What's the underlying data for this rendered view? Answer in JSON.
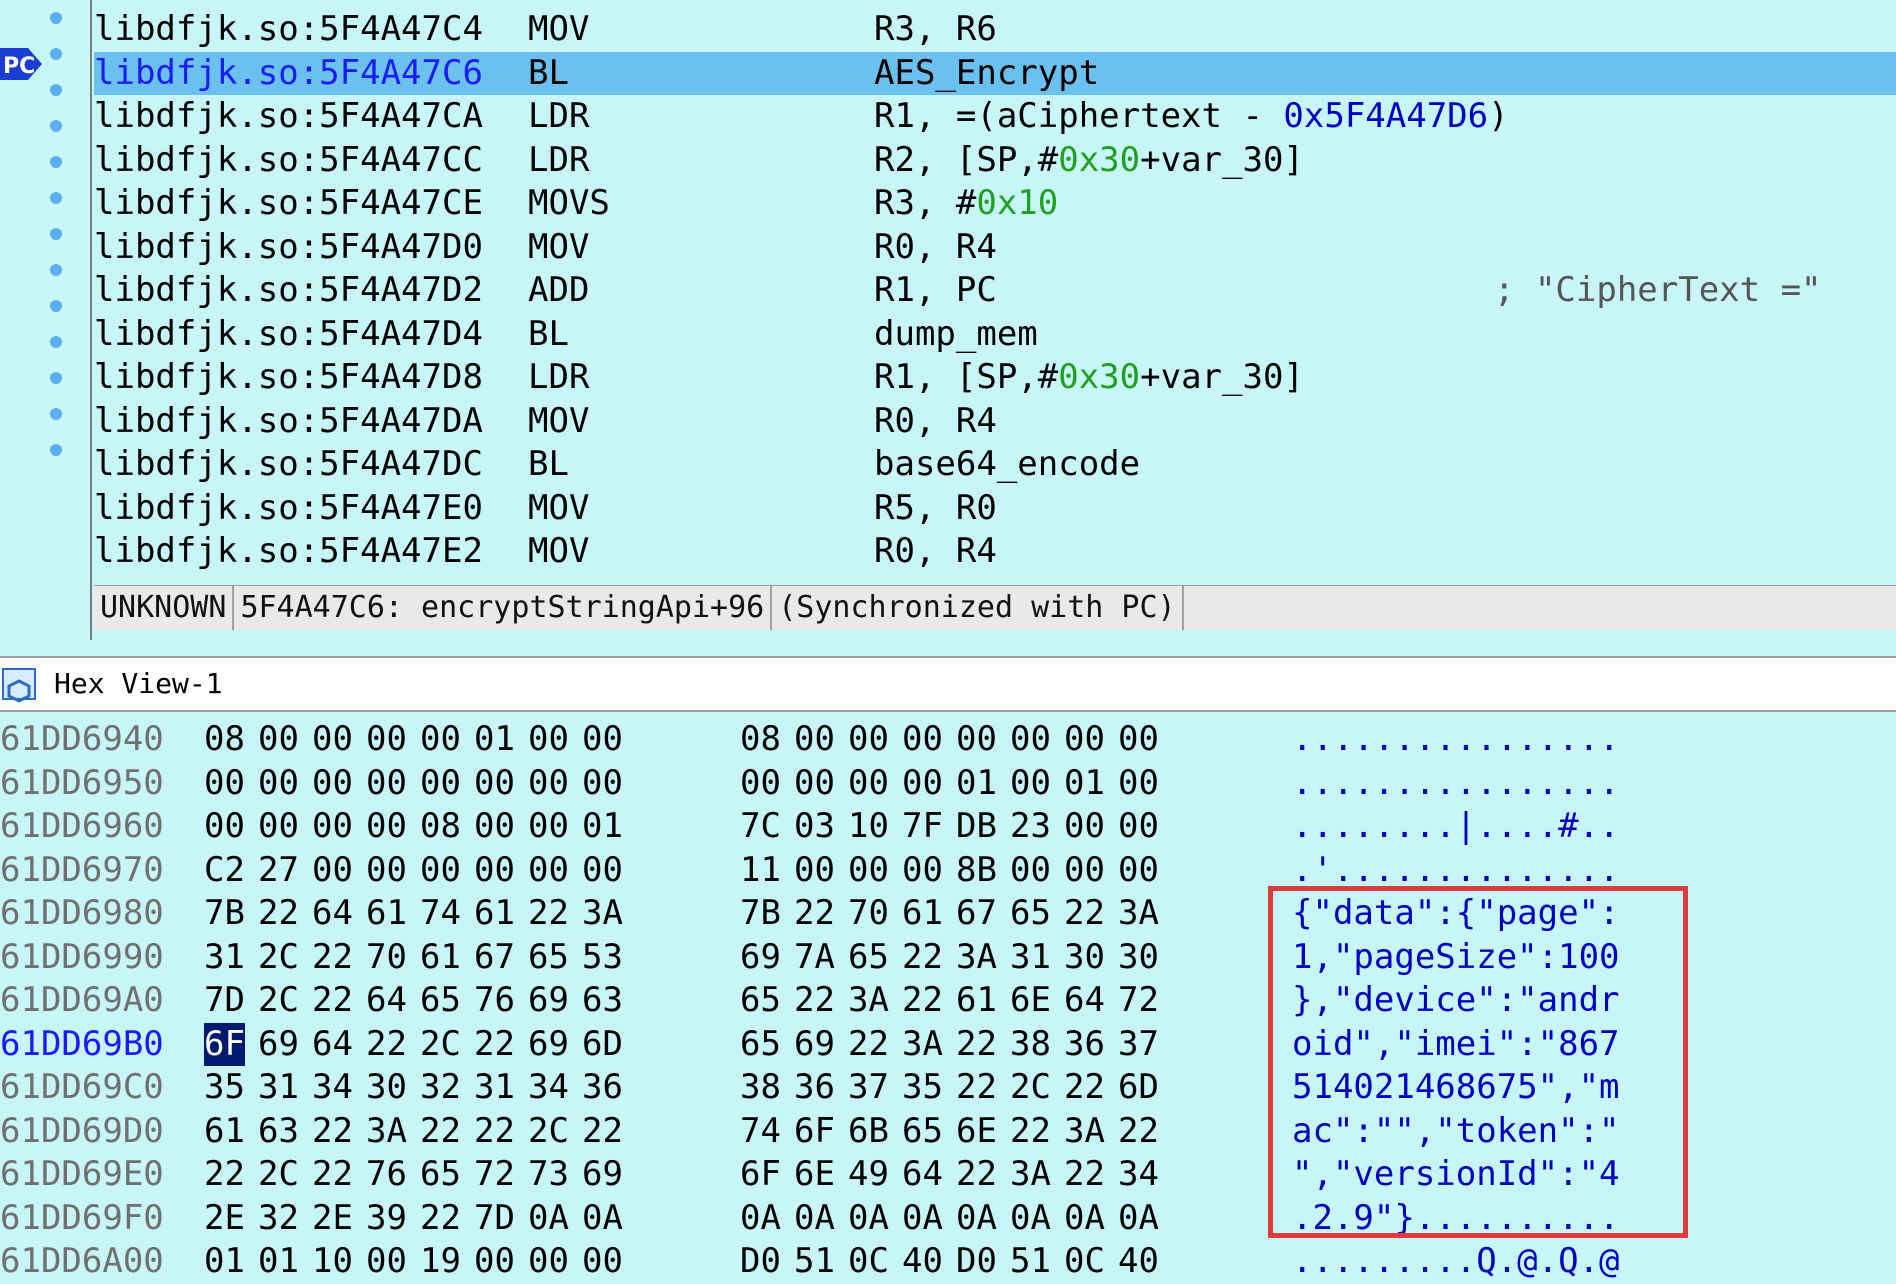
{
  "disasm": {
    "rows": [
      {
        "addr": "libdfjk.so:5F4A47C4",
        "mnemonic": "MOV",
        "operands": [
          [
            "R3, R6",
            ""
          ]
        ],
        "comment": ""
      },
      {
        "addr": "libdfjk.so:5F4A47C6",
        "mnemonic": "BL",
        "operands": [
          [
            "AES_Encrypt",
            ""
          ]
        ],
        "comment": "",
        "current": true
      },
      {
        "addr": "libdfjk.so:5F4A47CA",
        "mnemonic": "LDR",
        "operands": [
          [
            "R1, =(aCiphertext - ",
            ""
          ],
          [
            "0x5F4A47D6",
            "sym"
          ],
          [
            ")",
            ""
          ]
        ],
        "comment": ""
      },
      {
        "addr": "libdfjk.so:5F4A47CC",
        "mnemonic": "LDR",
        "operands": [
          [
            "R2, [SP,#",
            ""
          ],
          [
            "0x30",
            "num"
          ],
          [
            "+var_30]",
            ""
          ]
        ],
        "comment": ""
      },
      {
        "addr": "libdfjk.so:5F4A47CE",
        "mnemonic": "MOVS",
        "operands": [
          [
            "R3, #",
            ""
          ],
          [
            "0x10",
            "num"
          ]
        ],
        "comment": ""
      },
      {
        "addr": "libdfjk.so:5F4A47D0",
        "mnemonic": "MOV",
        "operands": [
          [
            "R0, R4",
            ""
          ]
        ],
        "comment": ""
      },
      {
        "addr": "libdfjk.so:5F4A47D2",
        "mnemonic": "ADD",
        "operands": [
          [
            "R1, PC",
            ""
          ]
        ],
        "comment": "; \"CipherText =\""
      },
      {
        "addr": "libdfjk.so:5F4A47D4",
        "mnemonic": "BL",
        "operands": [
          [
            "dump_mem",
            ""
          ]
        ],
        "comment": ""
      },
      {
        "addr": "libdfjk.so:5F4A47D8",
        "mnemonic": "LDR",
        "operands": [
          [
            "R1, [SP,#",
            ""
          ],
          [
            "0x30",
            "num"
          ],
          [
            "+var_30]",
            ""
          ]
        ],
        "comment": ""
      },
      {
        "addr": "libdfjk.so:5F4A47DA",
        "mnemonic": "MOV",
        "operands": [
          [
            "R0, R4",
            ""
          ]
        ],
        "comment": ""
      },
      {
        "addr": "libdfjk.so:5F4A47DC",
        "mnemonic": "BL",
        "operands": [
          [
            "base64_encode",
            ""
          ]
        ],
        "comment": ""
      },
      {
        "addr": "libdfjk.so:5F4A47E0",
        "mnemonic": "MOV",
        "operands": [
          [
            "R5, R0",
            ""
          ]
        ],
        "comment": ""
      },
      {
        "addr": "libdfjk.so:5F4A47E2",
        "mnemonic": "MOV",
        "operands": [
          [
            "R0, R4",
            ""
          ]
        ],
        "comment": ""
      }
    ],
    "pc_label": "PC",
    "status": {
      "segment": "UNKNOWN",
      "location": "5F4A47C6: encryptStringApi+96",
      "sync": "(Synchronized with PC)"
    }
  },
  "hexview": {
    "title": "Hex View-1",
    "rows": [
      {
        "addr": "61DD6940",
        "bytes": [
          "08",
          "00",
          "00",
          "00",
          "00",
          "01",
          "00",
          "00",
          "08",
          "00",
          "00",
          "00",
          "00",
          "00",
          "00",
          "00"
        ],
        "ascii": "................"
      },
      {
        "addr": "61DD6950",
        "bytes": [
          "00",
          "00",
          "00",
          "00",
          "00",
          "00",
          "00",
          "00",
          "00",
          "00",
          "00",
          "00",
          "01",
          "00",
          "01",
          "00"
        ],
        "ascii": "................"
      },
      {
        "addr": "61DD6960",
        "bytes": [
          "00",
          "00",
          "00",
          "00",
          "08",
          "00",
          "00",
          "01",
          "7C",
          "03",
          "10",
          "7F",
          "DB",
          "23",
          "00",
          "00"
        ],
        "ascii": "........|....#.."
      },
      {
        "addr": "61DD6970",
        "bytes": [
          "C2",
          "27",
          "00",
          "00",
          "00",
          "00",
          "00",
          "00",
          "11",
          "00",
          "00",
          "00",
          "8B",
          "00",
          "00",
          "00"
        ],
        "ascii": ".'.............."
      },
      {
        "addr": "61DD6980",
        "bytes": [
          "7B",
          "22",
          "64",
          "61",
          "74",
          "61",
          "22",
          "3A",
          "7B",
          "22",
          "70",
          "61",
          "67",
          "65",
          "22",
          "3A"
        ],
        "ascii": "{\"data\":{\"page\":"
      },
      {
        "addr": "61DD6990",
        "bytes": [
          "31",
          "2C",
          "22",
          "70",
          "61",
          "67",
          "65",
          "53",
          "69",
          "7A",
          "65",
          "22",
          "3A",
          "31",
          "30",
          "30"
        ],
        "ascii": "1,\"pageSize\":100"
      },
      {
        "addr": "61DD69A0",
        "bytes": [
          "7D",
          "2C",
          "22",
          "64",
          "65",
          "76",
          "69",
          "63",
          "65",
          "22",
          "3A",
          "22",
          "61",
          "6E",
          "64",
          "72"
        ],
        "ascii": "},\"device\":\"andr"
      },
      {
        "addr": "61DD69B0",
        "bytes": [
          "6F",
          "69",
          "64",
          "22",
          "2C",
          "22",
          "69",
          "6D",
          "65",
          "69",
          "22",
          "3A",
          "22",
          "38",
          "36",
          "37"
        ],
        "ascii": "oid\",\"imei\":\"867",
        "current": true,
        "selected_byte": 0
      },
      {
        "addr": "61DD69C0",
        "bytes": [
          "35",
          "31",
          "34",
          "30",
          "32",
          "31",
          "34",
          "36",
          "38",
          "36",
          "37",
          "35",
          "22",
          "2C",
          "22",
          "6D"
        ],
        "ascii": "514021468675\",\"m"
      },
      {
        "addr": "61DD69D0",
        "bytes": [
          "61",
          "63",
          "22",
          "3A",
          "22",
          "22",
          "2C",
          "22",
          "74",
          "6F",
          "6B",
          "65",
          "6E",
          "22",
          "3A",
          "22"
        ],
        "ascii": "ac\":\"\",\"token\":\""
      },
      {
        "addr": "61DD69E0",
        "bytes": [
          "22",
          "2C",
          "22",
          "76",
          "65",
          "72",
          "73",
          "69",
          "6F",
          "6E",
          "49",
          "64",
          "22",
          "3A",
          "22",
          "34"
        ],
        "ascii": "\",\"versionId\":\"4"
      },
      {
        "addr": "61DD69F0",
        "bytes": [
          "2E",
          "32",
          "2E",
          "39",
          "22",
          "7D",
          "0A",
          "0A",
          "0A",
          "0A",
          "0A",
          "0A",
          "0A",
          "0A",
          "0A",
          "0A"
        ],
        "ascii": ".2.9\"}.........."
      },
      {
        "addr": "61DD6A00",
        "bytes": [
          "01",
          "01",
          "10",
          "00",
          "19",
          "00",
          "00",
          "00",
          "D0",
          "51",
          "0C",
          "40",
          "D0",
          "51",
          "0C",
          "40"
        ],
        "ascii": ".........Q.@.Q.@"
      }
    ]
  },
  "colors": {
    "background": "#c8f5f8",
    "current_line": "#6ac0ee",
    "highlight_box": "#e03a3a",
    "number": "#1fa020",
    "symbol": "#0000c0"
  }
}
